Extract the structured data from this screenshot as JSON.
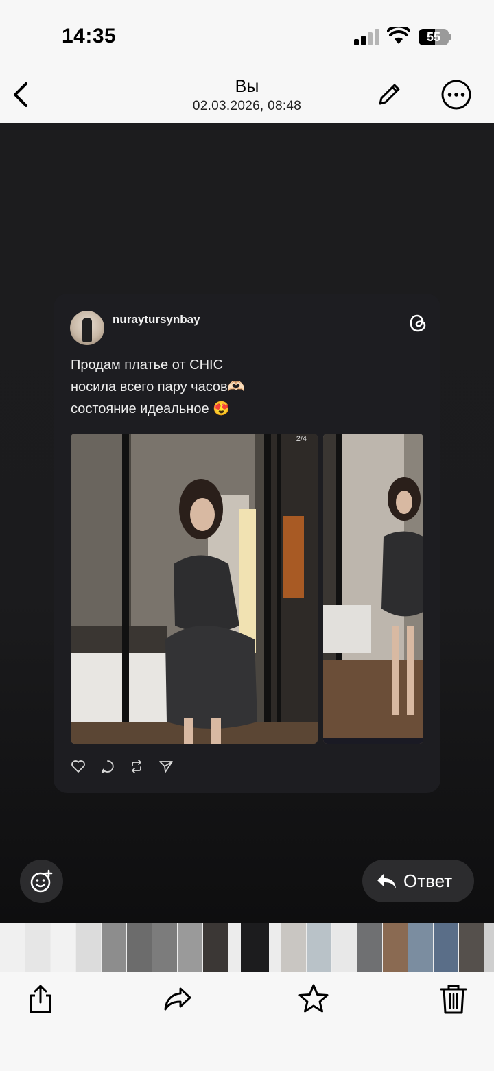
{
  "status_bar": {
    "time": "14:35",
    "battery_level": "55",
    "icons": [
      "cellular-signal-icon",
      "wifi-icon",
      "battery-icon"
    ]
  },
  "header": {
    "title": "Вы",
    "subtitle": "02.03.2026, 08:48",
    "icons": [
      "chevron-left-icon",
      "pencil-icon",
      "ellipsis-circle-icon"
    ]
  },
  "post": {
    "username": "nuraytursynbay",
    "text_lines": [
      "Продам платье от CHIC",
      "носила всего пару часов🫶🏻",
      "состояние идеальное 😍"
    ],
    "pager": "2/4",
    "actions": [
      "heart-icon",
      "comment-icon",
      "repost-icon",
      "send-icon"
    ]
  },
  "viewer_actions": {
    "emoji_icon": "add-reaction-icon",
    "reply_label": "Ответ",
    "reply_icon": "reply-arrow-icon"
  },
  "thumbnails": {
    "active_index": 9,
    "colors": [
      "#f0f0f0",
      "#e6e6e6",
      "#f2f2f2",
      "#dcdcdc",
      "#8d8d8d",
      "#6c6c6c",
      "#7c7c7c",
      "#9a9a9a",
      "#3b3735",
      "#1c1c1e",
      "#c9c6c2",
      "#b9c2c8",
      "#e8e8e8",
      "#6f7072",
      "#8a6a52",
      "#7b8da0",
      "#5a6e88",
      "#55504c",
      "#cfcfcf"
    ]
  },
  "toolbar": {
    "icons": [
      "share-icon",
      "forward-icon",
      "star-icon",
      "trash-icon"
    ]
  },
  "colors": {
    "viewer_bg": "#1c1c1e",
    "card_bg": "#1d1d21",
    "button_bg": "#2c2c2e",
    "chrome_bg": "#f7f7f7"
  }
}
